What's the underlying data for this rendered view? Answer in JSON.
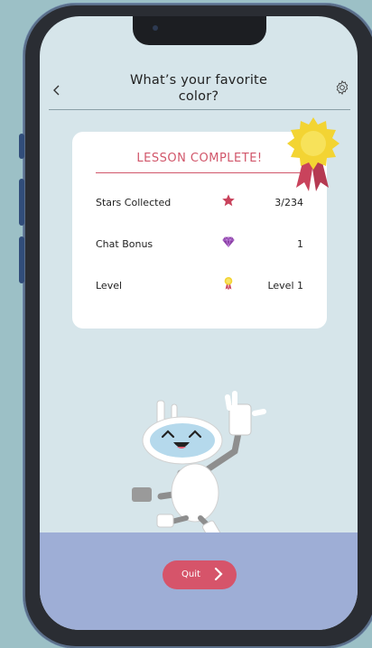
{
  "header": {
    "title": "What’s your favorite color?",
    "back_icon": "chevron-left-icon",
    "settings_icon": "gear-icon"
  },
  "card": {
    "title": "LESSON COMPLETE!",
    "badge_icon": "award-ribbon-icon",
    "rows": [
      {
        "label": "Stars Collected",
        "icon": "star-icon",
        "value": "3/234"
      },
      {
        "label": "Chat Bonus",
        "icon": "gem-icon",
        "value": "1"
      },
      {
        "label": "Level",
        "icon": "medal-icon",
        "value": "Level 1"
      }
    ]
  },
  "mascot": {
    "icon": "robot-mascot-icon"
  },
  "footer": {
    "quit_label": "Quit",
    "quit_icon": "chevron-right-icon"
  },
  "colors": {
    "accent": "#d6546a",
    "background": "#d6e5ea",
    "footer": "#9eaed6",
    "card": "#ffffff"
  }
}
